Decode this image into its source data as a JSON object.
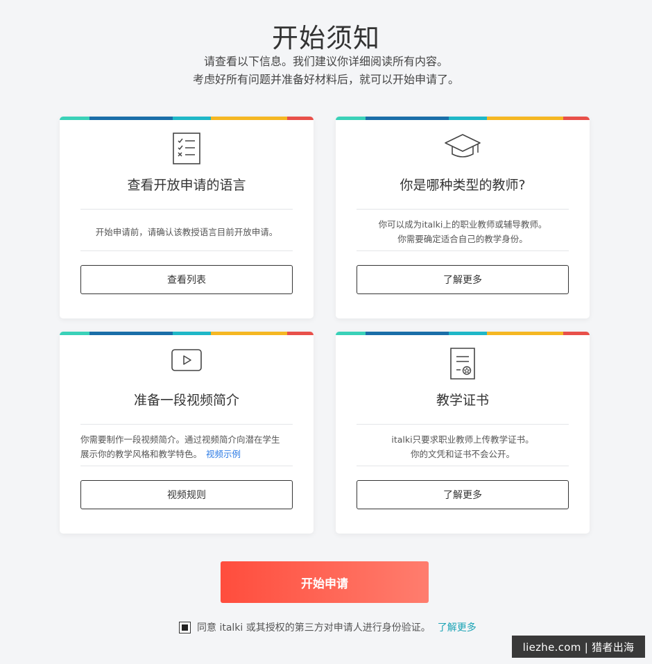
{
  "header": {
    "title": "开始须知",
    "subtitle_line1": "请查看以下信息。我们建议你详细阅读所有内容。",
    "subtitle_line2": "考虑好所有问题并准备好材料后，就可以开始申请了。"
  },
  "stripe_colors": [
    "#3ad1b8",
    "#1a6ea8",
    "#1fb7c7",
    "#f5b723",
    "#e8504a"
  ],
  "cards": [
    {
      "icon": "checklist-icon",
      "title": "查看开放申请的语言",
      "desc_line1": "开始申请前，请确认该教授语言目前开放申请。",
      "button": "查看列表"
    },
    {
      "icon": "graduation-cap-icon",
      "title": "你是哪种类型的教师?",
      "desc_line1": "你可以成为italki上的职业教师或辅导教师。",
      "desc_line2": "你需要确定适合自己的教学身份。",
      "button": "了解更多"
    },
    {
      "icon": "video-play-icon",
      "title": "准备一段视频简介",
      "desc_line1": "你需要制作一段视频简介。通过视频简介向潜在学生",
      "desc_line2": "展示你的教学风格和教学特色。",
      "desc_link": "视频示例",
      "button": "视频规则"
    },
    {
      "icon": "certificate-icon",
      "title": "教学证书",
      "desc_line1": "italki只要求职业教师上传教学证书。",
      "desc_line2": "你的文凭和证书不会公开。",
      "button": "了解更多"
    }
  ],
  "cta": {
    "label": "开始申请"
  },
  "consent": {
    "checked": true,
    "text": "同意 italki 或其授权的第三方对申请人进行身份验证。",
    "link": "了解更多"
  },
  "watermark": "liezhe.com | 猎者出海"
}
